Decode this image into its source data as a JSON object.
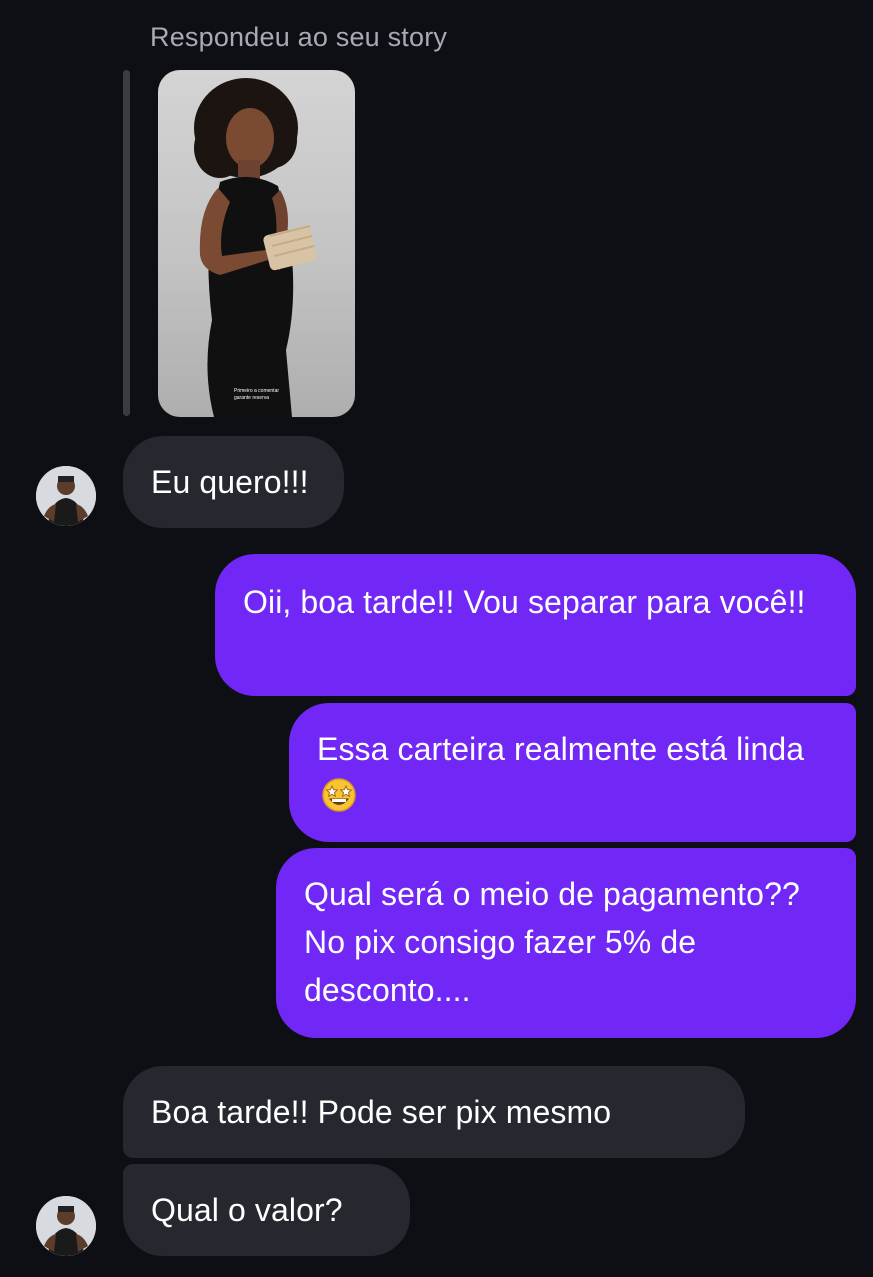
{
  "story_reply": {
    "label": "Respondeu ao seu story",
    "caption_line1": "Primeiro a comentar",
    "caption_line2": "garante reserva"
  },
  "messages": [
    {
      "side": "incoming",
      "text": "Eu quero!!!"
    },
    {
      "side": "outgoing",
      "text": "Oii, boa tarde!! Vou separar para você!!"
    },
    {
      "side": "outgoing",
      "text": "Essa carteira realmente está linda",
      "emoji": "star-struck-emoji"
    },
    {
      "side": "outgoing",
      "text": "Qual será o meio de pagamento?? No pix consigo fazer 5% de desconto...."
    },
    {
      "side": "incoming",
      "text": "Boa tarde!! Pode ser pix mesmo"
    },
    {
      "side": "incoming",
      "text": "Qual o valor?"
    }
  ],
  "colors": {
    "background": "#0e0f15",
    "incoming_bubble": "#262830",
    "outgoing_bubble": "#7127f5",
    "meta_text": "#a8abb4"
  }
}
